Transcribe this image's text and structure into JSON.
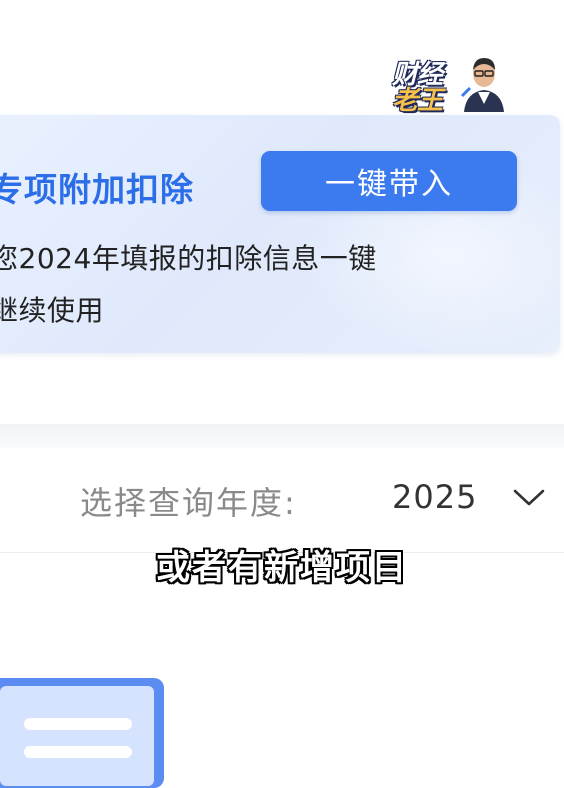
{
  "watermark": {
    "line1": "财经",
    "line2": "老王",
    "icon": "person-avatar-icon"
  },
  "banner": {
    "title": "专项附加扣除",
    "button_label": "一键带入",
    "description_line1": "您2024年填报的扣除信息一键",
    "description_line2": "继续使用",
    "accent_color": "#2b6ee8",
    "button_color": "#3c7bef"
  },
  "year_selector": {
    "label": "选择查询年度:",
    "value": "2025",
    "icon": "chevron-down-icon"
  },
  "caption": "或者有新增项目",
  "document_icon": "document-icon"
}
